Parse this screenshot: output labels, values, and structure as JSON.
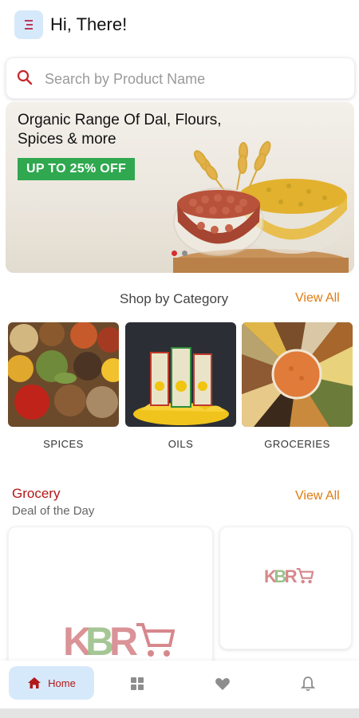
{
  "header": {
    "greeting": "Hi, There!",
    "menu_icon": "menu-icon"
  },
  "search": {
    "placeholder": "Search by Product Name",
    "value": "",
    "icon": "search-icon"
  },
  "banner": {
    "title": "Organic Range Of Dal, Flours, Spices & more",
    "badge": "UP TO 25% OFF",
    "slide_count": 2,
    "active_slide": 1
  },
  "categories": {
    "title": "Shop by Category",
    "view_all": "View All",
    "items": [
      {
        "label": "SPICES"
      },
      {
        "label": "OILS"
      },
      {
        "label": "GROCERIES"
      }
    ]
  },
  "grocery": {
    "title": "Grocery",
    "subtitle": "Deal of the Day",
    "view_all": "View All"
  },
  "bottom_nav": {
    "items": [
      {
        "label": "Home",
        "icon": "home-icon",
        "active": true
      },
      {
        "label": "",
        "icon": "categories-icon",
        "active": false
      },
      {
        "label": "",
        "icon": "heart-icon",
        "active": false
      },
      {
        "label": "",
        "icon": "bell-icon",
        "active": false
      }
    ]
  },
  "colors": {
    "accent_blue": "#d6e9fb",
    "brand_red": "#b11818",
    "link_orange": "#e07b10",
    "badge_green": "#2fa84f"
  }
}
